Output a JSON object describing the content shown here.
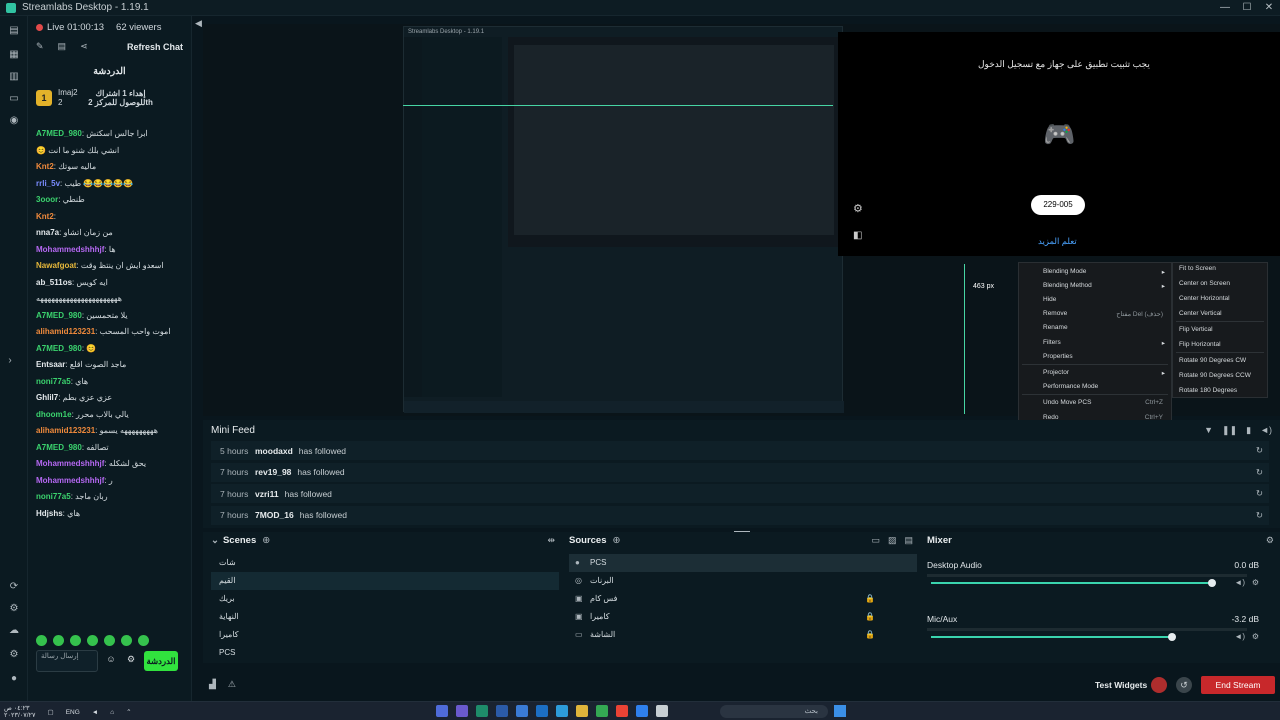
{
  "window": {
    "title": "Streamlabs Desktop - 1.19.1",
    "buttons": [
      "—",
      "☐",
      "✕"
    ]
  },
  "chat": {
    "live_status": "Live 01:00:13",
    "viewers": "62 viewers",
    "refresh_label": "Refresh Chat",
    "header": "الدردشة",
    "pinned": {
      "badge": "1",
      "user": "Imaj2",
      "count": "2",
      "message": "إهداء 1 اشتراك للوصول للمركز 2th"
    },
    "lines": [
      {
        "name": "A7MED_980",
        "color": "#3bd36e",
        "text": "ابرا جالس اسكتش"
      },
      {
        "name": "",
        "color": "#d6dde1",
        "text": "😊 انشي بلك شنو ما انت"
      },
      {
        "name": "Knt2",
        "color": "#f08a3c",
        "text": "ماليه سوتك"
      },
      {
        "name": "rrli_5v",
        "color": "#7a8cff",
        "text": "طيب 😂😂😂😂😂"
      },
      {
        "name": "3ooor",
        "color": "#3bd36e",
        "text": "طنطي"
      },
      {
        "name": "Knt2",
        "color": "#f08a3c",
        "text": ""
      },
      {
        "name": "nna7a",
        "color": "#e4e9ec",
        "text": "من زمان اتشاو"
      },
      {
        "name": "Mohammedshhhjf",
        "color": "#b568f2",
        "text": "ها"
      },
      {
        "name": "Nawafgoat",
        "color": "#e6b83b",
        "text": "اسعدو ايش ان ينتظ وقت"
      },
      {
        "name": "ab_511os",
        "color": "#e4e9ec",
        "text": "ايه كويس"
      },
      {
        "name": "",
        "color": "#d6dde1",
        "text": "ههههههههههههههههههههههه"
      },
      {
        "name": "A7MED_980",
        "color": "#3bd36e",
        "text": "يلا متحمسين"
      },
      {
        "name": "alihamid123231",
        "color": "#f08a3c",
        "text": "اموت واحب المسحب"
      },
      {
        "name": "A7MED_980",
        "color": "#3bd36e",
        "text": "😊"
      },
      {
        "name": "Entsaar",
        "color": "#e4e9ec",
        "text": "ماجد الصوت اقلع"
      },
      {
        "name": "noni77a5",
        "color": "#3bd36e",
        "text": "هاي"
      },
      {
        "name": "Ghlil7",
        "color": "#e4e9ec",
        "text": "عزي عزي بطم"
      },
      {
        "name": "dhoom1e",
        "color": "#3bd36e",
        "text": "يالي بالاب محرر"
      },
      {
        "name": "alihamid123231",
        "color": "#f08a3c",
        "text": "هههههههههه يسمو"
      },
      {
        "name": "A7MED_980",
        "color": "#3bd36e",
        "text": "تصالفه"
      },
      {
        "name": "Mohammedshhhjf",
        "color": "#b568f2",
        "text": "يحق لشكله"
      },
      {
        "name": "Mohammedshhhjf",
        "color": "#b568f2",
        "text": "ر"
      },
      {
        "name": "noni77a5",
        "color": "#3bd36e",
        "text": "ربان ماجد"
      },
      {
        "name": "Hdjshs",
        "color": "#e4e9ec",
        "text": "هاي"
      }
    ],
    "input_placeholder": "إرسال رسالة",
    "send_label": "الدردشة"
  },
  "preview": {
    "overlay_message": "يجب تثبيت تطبيق على جهاز مع تسجيل الدخول",
    "overlay_code": "229-005",
    "overlay_link": "تعلم المزيد",
    "pixel_label": "463 px",
    "inner_title": "Streamlabs Desktop - 1.19.1"
  },
  "context_menu": {
    "items": [
      {
        "label": "Blending Mode",
        "shortcut": "",
        "submenu": true
      },
      {
        "label": "Blending Method",
        "shortcut": "",
        "submenu": true
      },
      {
        "label": "Hide",
        "shortcut": "",
        "submenu": false
      },
      {
        "label": "Remove",
        "shortcut": "مفتاح Del (حذف)",
        "submenu": false
      },
      {
        "label": "Rename",
        "shortcut": "",
        "submenu": false
      },
      {
        "label": "Filters",
        "shortcut": "",
        "submenu": true
      },
      {
        "label": "Properties",
        "shortcut": "",
        "submenu": false
      },
      {
        "label": "Projector",
        "shortcut": "",
        "submenu": true
      },
      {
        "label": "Performance Mode",
        "shortcut": "",
        "submenu": false
      },
      {
        "label": "Undo Move PCS",
        "shortcut": "Ctrl+Z",
        "submenu": false
      },
      {
        "label": "Redo",
        "shortcut": "Ctrl+Y",
        "submenu": false
      }
    ],
    "submenu": [
      "Fit to Screen",
      "Center on Screen",
      "Center Horizontal",
      "Center Vertical",
      "Flip Vertical",
      "Flip Horizontal",
      "Rotate 90 Degrees CW",
      "Rotate 90 Degrees CCW",
      "Rotate 180 Degrees"
    ]
  },
  "minifeed": {
    "title": "Mini Feed",
    "rows": [
      {
        "time": "5 hours",
        "name": "moodaxd",
        "action": "has followed"
      },
      {
        "time": "7 hours",
        "name": "rev19_98",
        "action": "has followed"
      },
      {
        "time": "7 hours",
        "name": "vzri11",
        "action": "has followed"
      },
      {
        "time": "7 hours",
        "name": "7MOD_16",
        "action": "has followed"
      }
    ]
  },
  "scenes": {
    "title": "Scenes",
    "items": [
      "شات",
      "القيم",
      "بريك",
      "النهاية",
      "كاميرا",
      "PCS"
    ],
    "selected": 1
  },
  "sources": {
    "title": "Sources",
    "items": [
      {
        "label": "PCS",
        "icon": "●",
        "locked": false
      },
      {
        "label": "البرنات",
        "icon": "◎",
        "locked": false
      },
      {
        "label": "فس كام",
        "icon": "▣",
        "locked": true
      },
      {
        "label": "كاميرا",
        "icon": "▣",
        "locked": true
      },
      {
        "label": "الشاشة",
        "icon": "▭",
        "locked": true
      }
    ]
  },
  "mixer": {
    "title": "Mixer",
    "channels": [
      {
        "name": "Desktop Audio",
        "db": "0.0 dB",
        "level": 0.97
      },
      {
        "name": "Mic/Aux",
        "db": "-3.2 dB",
        "level": 0.83
      }
    ]
  },
  "footer": {
    "test_widgets": "Test Widgets",
    "end_stream": "End Stream"
  },
  "taskbar": {
    "time": "٠٤:٢٣ ص",
    "date": "٢٠٢٣/٠٧/٢٧",
    "lang": "ENG",
    "search": "بحث"
  },
  "colors": {
    "accent": "#31c3a2",
    "live": "#e24a4a",
    "end_stream": "#c8282b",
    "send": "#31e23e"
  }
}
